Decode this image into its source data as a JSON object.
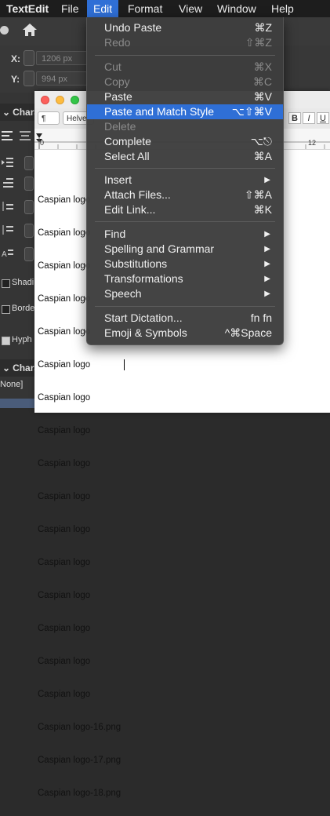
{
  "menubar": {
    "app": "TextEdit",
    "items": [
      "File",
      "Edit",
      "Format",
      "View",
      "Window",
      "Help"
    ],
    "active": "Edit"
  },
  "background_app": {
    "x_label": "X:",
    "x_value": "1206 px",
    "y_label": "Y:",
    "y_value": "994 px",
    "panel_char_header": "Chara",
    "panel_char_header_2": "Chara",
    "shading_label": "Shadi",
    "border_label": "Borde",
    "hyphen_label": "Hyph",
    "none_label": "None]"
  },
  "textedit": {
    "font_popup": "¶",
    "font_name": "Helve",
    "bold": "B",
    "italic": "I",
    "underline": "U",
    "ruler_zero": "0",
    "ruler_twelve": "12",
    "lines": [
      "Caspian logo",
      "Caspian logo",
      "Caspian logo",
      "Caspian logo",
      "Caspian logo",
      "Caspian logo",
      "Caspian logo",
      "Caspian logo",
      "Caspian logo",
      "Caspian logo",
      "Caspian logo",
      "Caspian logo",
      "Caspian logo",
      "Caspian logo",
      "Caspian logo",
      "Caspian logo",
      "Caspian logo-16.png",
      "Caspian logo-17.png",
      "Caspian logo-18.png"
    ]
  },
  "edit_menu": {
    "groups": [
      [
        {
          "label": "Undo Paste",
          "shortcut": "⌘Z",
          "enabled": true
        },
        {
          "label": "Redo",
          "shortcut": "⇧⌘Z",
          "enabled": false
        }
      ],
      [
        {
          "label": "Cut",
          "shortcut": "⌘X",
          "enabled": false
        },
        {
          "label": "Copy",
          "shortcut": "⌘C",
          "enabled": false
        },
        {
          "label": "Paste",
          "shortcut": "⌘V",
          "enabled": true
        },
        {
          "label": "Paste and Match Style",
          "shortcut": "⌥⇧⌘V",
          "enabled": true,
          "highlighted": true
        },
        {
          "label": "Delete",
          "shortcut": "",
          "enabled": false
        },
        {
          "label": "Complete",
          "shortcut": "⌥⎋",
          "enabled": true
        },
        {
          "label": "Select All",
          "shortcut": "⌘A",
          "enabled": true
        }
      ],
      [
        {
          "label": "Insert",
          "submenu": true,
          "enabled": true
        },
        {
          "label": "Attach Files...",
          "shortcut": "⇧⌘A",
          "enabled": true
        },
        {
          "label": "Edit Link...",
          "shortcut": "⌘K",
          "enabled": true
        }
      ],
      [
        {
          "label": "Find",
          "submenu": true,
          "enabled": true
        },
        {
          "label": "Spelling and Grammar",
          "submenu": true,
          "enabled": true
        },
        {
          "label": "Substitutions",
          "submenu": true,
          "enabled": true
        },
        {
          "label": "Transformations",
          "submenu": true,
          "enabled": true
        },
        {
          "label": "Speech",
          "submenu": true,
          "enabled": true
        }
      ],
      [
        {
          "label": "Start Dictation...",
          "shortcut": "fn fn",
          "enabled": true
        },
        {
          "label": "Emoji & Symbols",
          "shortcut": "^⌘Space",
          "enabled": true
        }
      ]
    ]
  },
  "colors": {
    "menubar_bg": "#1d1d1d",
    "menu_bg": "#3e3e3e",
    "highlight": "#2f6fd6",
    "disabled_text": "#8a8a8a"
  }
}
